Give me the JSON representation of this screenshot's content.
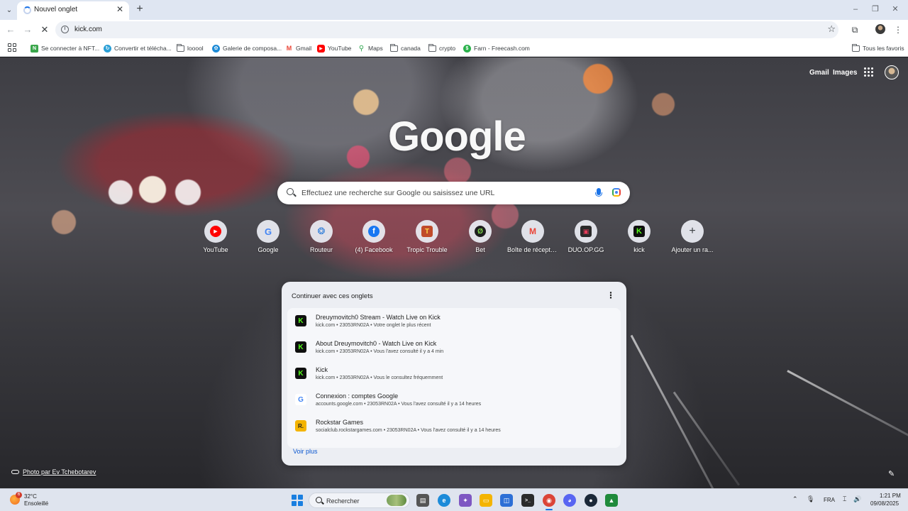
{
  "browser": {
    "tab_title": "Nouvel onglet",
    "url": "kick.com",
    "icons": {
      "tab_menu": "chevron-down-icon",
      "spinner": "loading-spinner",
      "close": "close-icon",
      "new_tab": "plus-icon",
      "back": "back-arrow-icon",
      "forward": "forward-arrow-icon",
      "reload": "reload-icon",
      "site_info": "info-icon",
      "bookmark": "star-icon",
      "extensions": "puzzle-icon",
      "menu": "kebab-menu-icon"
    },
    "glyphs": {
      "tab_menu": "⌄",
      "close": "✕",
      "new_tab": "+",
      "back": "←",
      "forward": "→",
      "reload": "✕",
      "info": "i",
      "star": "☆",
      "extensions": "⧉",
      "menu": "⋮",
      "minimize": "–",
      "restore": "❐",
      "window_close": "✕"
    }
  },
  "bookmarks": [
    {
      "label": "Se connecter à NFT...",
      "icon": "nft-icon",
      "color": "#3aa64b"
    },
    {
      "label": "Convertir et télécha...",
      "icon": "convert-icon",
      "color": "#2a9fd6"
    },
    {
      "label": "looool",
      "icon": "folder-icon"
    },
    {
      "label": "Galerie de composa...",
      "icon": "gallery-icon",
      "color": "#1e8bd6"
    },
    {
      "label": "Gmail",
      "icon": "gmail-icon",
      "color": "#ea4335"
    },
    {
      "label": "YouTube",
      "icon": "youtube-icon",
      "color": "#ff0000"
    },
    {
      "label": "Maps",
      "icon": "maps-icon",
      "color": "#34a853"
    },
    {
      "label": "canada",
      "icon": "folder-icon"
    },
    {
      "label": "crypto",
      "icon": "folder-icon"
    },
    {
      "label": "Farn - Freecash.com",
      "icon": "freecash-icon",
      "color": "#2bb24c"
    }
  ],
  "all_bookmarks": "Tous les favoris",
  "ntp": {
    "gmail": "Gmail",
    "images": "Images",
    "logo": "Google",
    "search_placeholder": "Effectuez une recherche sur Google ou saisissez une URL",
    "shortcuts": [
      {
        "label": "YouTube",
        "icon": "youtube-icon",
        "glyph": "▶",
        "color": "#ff0000"
      },
      {
        "label": "Google",
        "icon": "google-icon",
        "glyph": "G",
        "color": "#4285f4"
      },
      {
        "label": "Routeur",
        "icon": "router-icon",
        "glyph": "❂",
        "color": "#2b7bd8"
      },
      {
        "label": "(4) Facebook",
        "icon": "facebook-icon",
        "glyph": "f",
        "color": "#1877f2"
      },
      {
        "label": "Tropic Trouble",
        "icon": "tropic-trouble-icon",
        "glyph": "T",
        "color": "#c04a2a"
      },
      {
        "label": "Bet",
        "icon": "bet-icon",
        "glyph": "Ø",
        "color": "#2e7d32"
      },
      {
        "label": "Boîte de réception (2...",
        "icon": "gmail-icon",
        "glyph": "M",
        "color": "#ea4335"
      },
      {
        "label": "DUO.OP.GG",
        "icon": "duo-opgg-icon",
        "glyph": "▣",
        "color": "#2a2a2a"
      },
      {
        "label": "kick",
        "icon": "kick-icon",
        "glyph": "K",
        "color": "#53fc18"
      },
      {
        "label": "Ajouter un ra...",
        "icon": "plus-icon",
        "glyph": "+",
        "color": "#3c4043"
      }
    ],
    "continue_title": "Continuer avec ces onglets",
    "continue_items": [
      {
        "title": "Dreuymovitch0 Stream - Watch Live on Kick",
        "subtitle": "kick.com • 23053RN02A • Votre onglet le plus récent",
        "icon": "kick-icon",
        "glyph": "K"
      },
      {
        "title": "About Dreuymovitch0 - Watch Live on Kick",
        "subtitle": "kick.com • 23053RN02A • Vous l'avez consulté il y a 4 min",
        "icon": "kick-icon",
        "glyph": "K"
      },
      {
        "title": "Kick",
        "subtitle": "kick.com • 23053RN02A • Vous le consultez fréquemment",
        "icon": "kick-icon",
        "glyph": "K"
      },
      {
        "title": "Connexion : comptes Google",
        "subtitle": "accounts.google.com • 23053RN02A • Vous l'avez consulté il y a 14 heures",
        "icon": "google-icon",
        "glyph": "G"
      },
      {
        "title": "Rockstar Games",
        "subtitle": "socialclub.rockstargames.com • 23053RN02A • Vous l'avez consulté il y a 14 heures",
        "icon": "rockstar-icon",
        "glyph": "R."
      }
    ],
    "see_more": "Voir plus",
    "photo_credit": "Photo par Ev Tchebotarev"
  },
  "taskbar": {
    "weather_badge": "6",
    "temperature": "32°C",
    "weather": "Ensoleillé",
    "search_placeholder": "Rechercher",
    "language": "FRA",
    "time": "1:21 PM",
    "date": "09/08/2025",
    "apps": [
      {
        "icon": "file-explorer-icon",
        "glyph": "▤",
        "color": "#555555"
      },
      {
        "icon": "edge-icon",
        "glyph": "e",
        "color": "#1c8bd9"
      },
      {
        "icon": "copilot-icon",
        "glyph": "✦",
        "color": "#7e57c2"
      },
      {
        "icon": "folder-icon",
        "glyph": "▭",
        "color": "#f4b400"
      },
      {
        "icon": "store-icon",
        "glyph": "◫",
        "color": "#2d6fd6"
      },
      {
        "icon": "terminal-icon",
        "glyph": ">_",
        "color": "#2b2b2b"
      },
      {
        "icon": "chrome-icon",
        "glyph": "◉",
        "color": "#db4437"
      },
      {
        "icon": "discord-icon",
        "glyph": "◕",
        "color": "#5865f2"
      },
      {
        "icon": "steam-icon",
        "glyph": "●",
        "color": "#1b2838"
      },
      {
        "icon": "nvidia-icon",
        "glyph": "▲",
        "color": "#1f8a3b"
      }
    ],
    "tray_glyphs": {
      "overflow": "⌃",
      "mic": "🎙",
      "network": "⌶",
      "volume": "🔊"
    }
  }
}
